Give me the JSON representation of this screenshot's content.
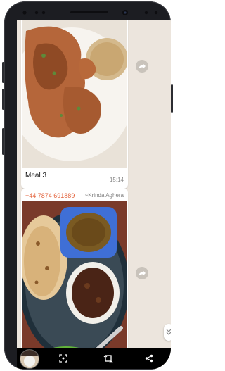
{
  "messages": [
    {
      "caption": "Meal 3",
      "time": "15:14",
      "image": "photo of fried pancakes and a round flatbread on a white plate"
    },
    {
      "phone": "+44 7874 691889",
      "sender": "~Krinda Aghera",
      "image": "photo of chapatis, curry bowl, sabzi and raita on a patterned tray"
    }
  ],
  "icons": {
    "share": "share-forward-icon",
    "scroll": "double-chevron-down-icon",
    "nav": [
      "focus-icon",
      "rotate-icon",
      "share-icon"
    ]
  },
  "colors": {
    "chat_background": "#ece5dd",
    "sender_phone": "#e3623b",
    "nav_bar": "#000000"
  }
}
